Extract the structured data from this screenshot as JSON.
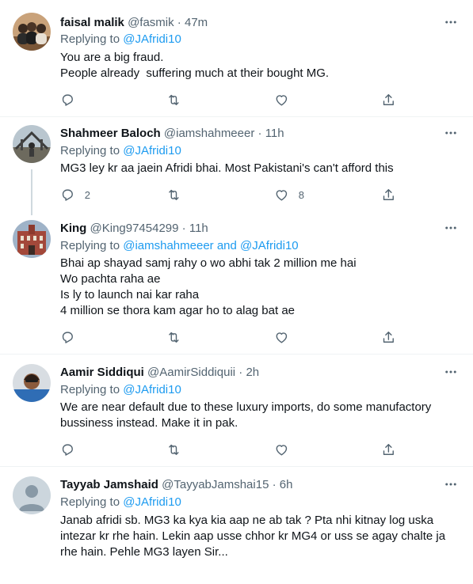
{
  "theme": {
    "link_color": "#1d9bf0",
    "text_color": "#0f1419",
    "muted_color": "#536471"
  },
  "icons": {
    "reply": "reply-icon",
    "retweet": "retweet-icon",
    "like": "heart-icon",
    "share": "share-icon",
    "more": "more-icon"
  },
  "tweets": [
    {
      "name": "faisal malik",
      "handle": "@fasmik",
      "sep": " · ",
      "time": "47m",
      "replying_prefix": "Replying to ",
      "replying_to": "@JAfridi10",
      "replying_mid": "",
      "replying_to2": "",
      "lines": [
        "You are a big fraud.",
        "People already  suffering much at their bought MG."
      ],
      "replies": "",
      "retweets": "",
      "likes": ""
    },
    {
      "name": "Shahmeer Baloch",
      "handle": "@iamshahmeeer",
      "sep": " · ",
      "time": "11h",
      "replying_prefix": "Replying to ",
      "replying_to": "@JAfridi10",
      "replying_mid": "",
      "replying_to2": "",
      "lines": [
        "MG3 ley kr aa jaein Afridi bhai. Most Pakistani's can't afford this"
      ],
      "replies": "2",
      "retweets": "",
      "likes": "8"
    },
    {
      "name": "King",
      "handle": "@King97454299",
      "sep": " · ",
      "time": "11h",
      "replying_prefix": "Replying to ",
      "replying_to": "@iamshahmeeer",
      "replying_mid": " and ",
      "replying_to2": "@JAfridi10",
      "lines": [
        "Bhai ap shayad samj rahy o wo abhi tak 2 million me hai",
        "Wo pachta raha ae",
        "Is ly to launch nai kar raha",
        "4 million se thora kam agar ho to alag bat ae"
      ],
      "replies": "",
      "retweets": "",
      "likes": ""
    },
    {
      "name": "Aamir Siddiqui",
      "handle": "@AamirSiddiquii",
      "sep": " · ",
      "time": "2h",
      "replying_prefix": "Replying to ",
      "replying_to": "@JAfridi10",
      "replying_mid": "",
      "replying_to2": "",
      "lines": [
        "We are near default due to these luxury imports, do some manufactory",
        "bussiness instead. Make it in pak."
      ],
      "replies": "",
      "retweets": "",
      "likes": ""
    },
    {
      "name": "Tayyab Jamshaid",
      "handle": "@TayyabJamshai15",
      "sep": " · ",
      "time": "6h",
      "replying_prefix": "Replying to ",
      "replying_to": "@JAfridi10",
      "replying_mid": "",
      "replying_to2": "",
      "lines": [
        "Janab afridi sb. MG3 ka kya kia aap ne ab tak ? Pta nhi kitnay log uska",
        "intezar kr rhe hain. Lekin aap usse chhor kr MG4 or uss se agay chalte ja",
        "rhe hain. Pehle MG3 layen Sir..."
      ],
      "replies": "",
      "retweets": "",
      "likes": ""
    }
  ]
}
